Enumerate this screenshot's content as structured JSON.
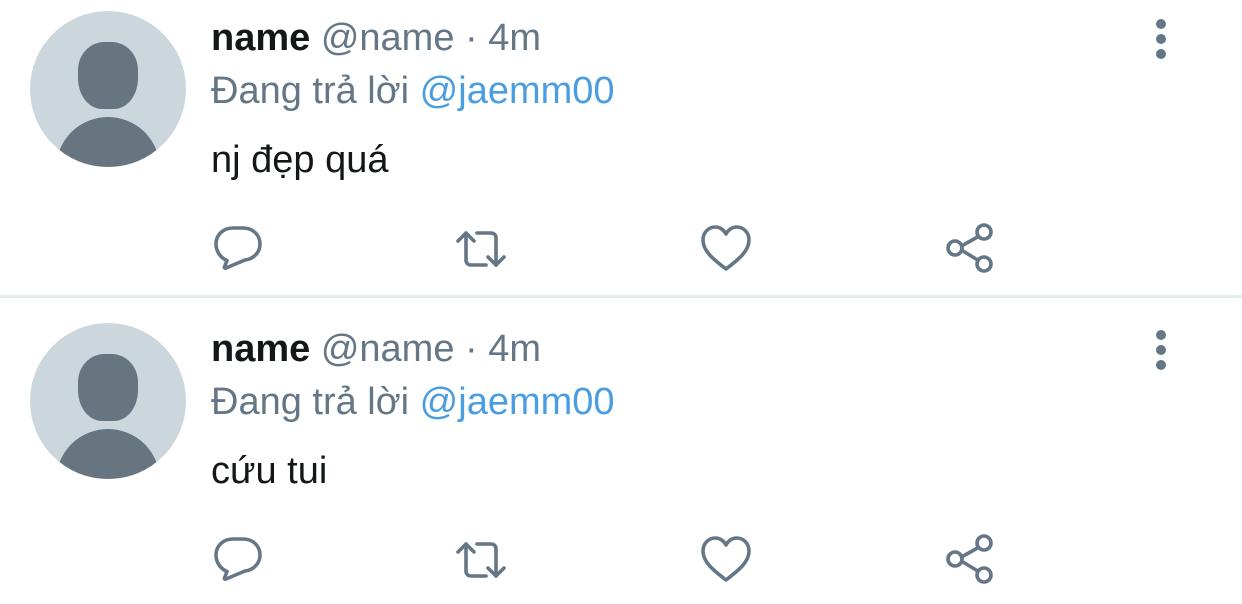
{
  "tweets": [
    {
      "name": "name",
      "handle": "@name",
      "separator": "·",
      "time": "4m",
      "reply_prefix": "Đang trả lời",
      "reply_to": "@jaemm00",
      "text": "nj đẹp quá"
    },
    {
      "name": "name",
      "handle": "@name",
      "separator": "·",
      "time": "4m",
      "reply_prefix": "Đang trả lời",
      "reply_to": "@jaemm00",
      "text": "cứu tui"
    }
  ],
  "icons": {
    "more": "more-vertical-icon",
    "reply": "reply-icon",
    "retweet": "retweet-icon",
    "like": "heart-icon",
    "share": "share-icon"
  },
  "colors": {
    "text": "#14171a",
    "secondary": "#657786",
    "mention": "#4a9de0",
    "avatar_bg": "#ccd6dd",
    "avatar_fg": "#66757f",
    "divider": "#e6ecf0"
  }
}
